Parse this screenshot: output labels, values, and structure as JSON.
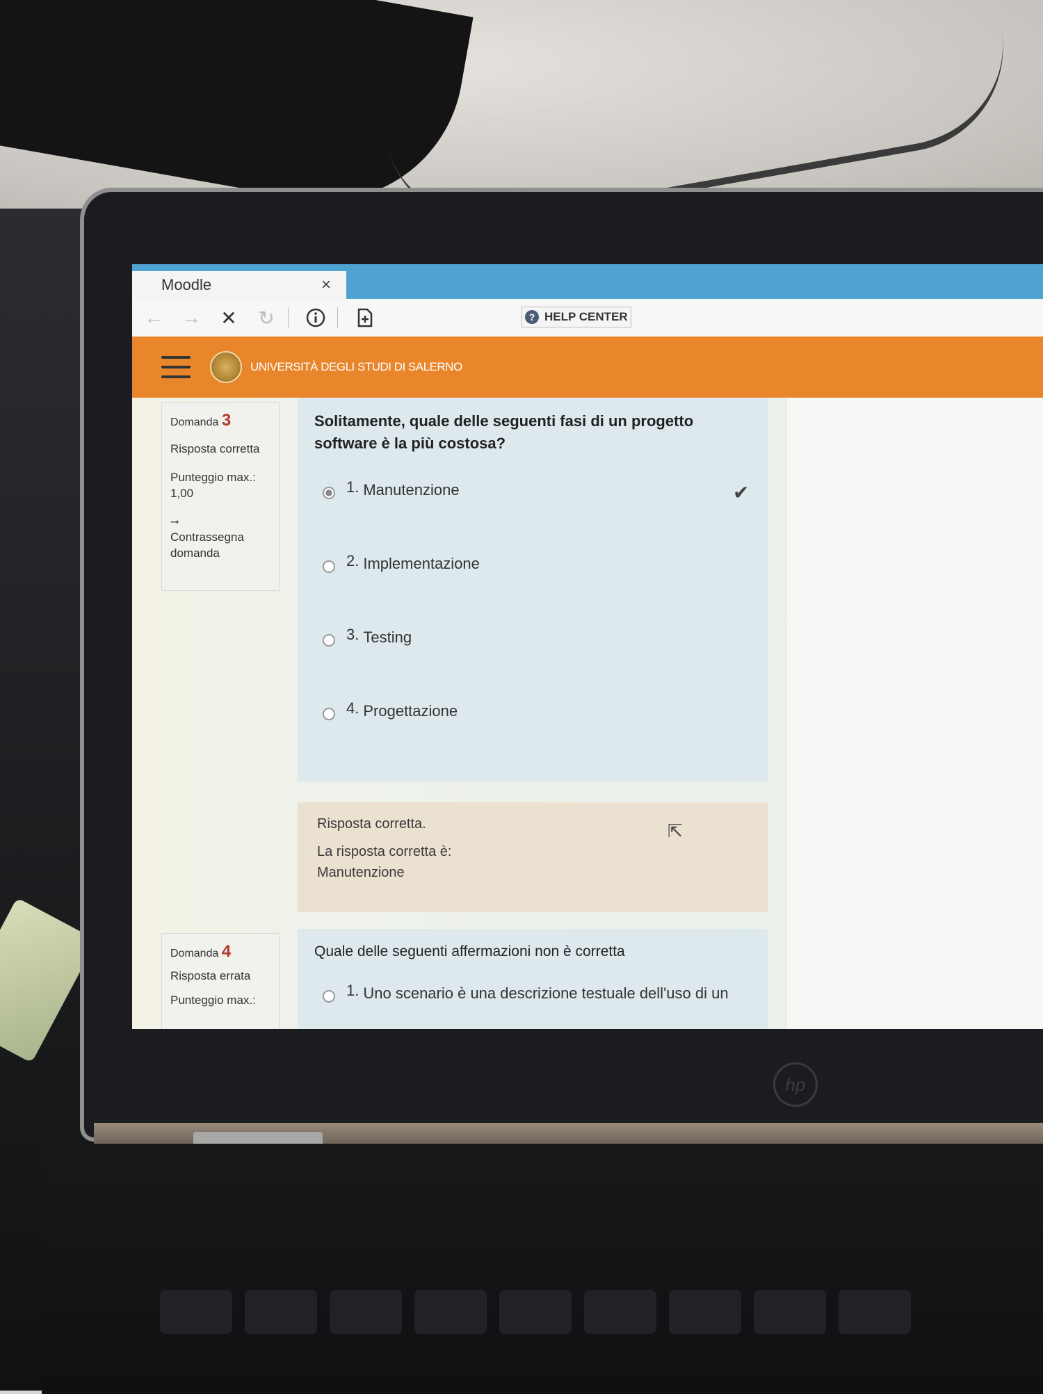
{
  "browser": {
    "tab_title": "Moodle",
    "tab_close": "×",
    "help_center": "HELP CENTER",
    "help_icon": "?",
    "icons": [
      "back-arrow-icon",
      "forward-arrow-icon",
      "stop-icon",
      "reload-icon",
      "info-icon",
      "add-page-icon"
    ]
  },
  "site": {
    "university": "UNIVERSITÀ DEGLI STUDI DI SALERNO",
    "brand_color": "#e9862c"
  },
  "question3": {
    "label": "Domanda",
    "number": "3",
    "status": "Risposta corretta",
    "max_score_label": "Punteggio max.:",
    "max_score": "1,00",
    "flag_label": "Contrassegna domanda",
    "text": "Solitamente, quale delle seguenti fasi di un progetto software è la più costosa?",
    "options": [
      {
        "num": "1.",
        "label": "Manutenzione",
        "selected": true
      },
      {
        "num": "2.",
        "label": "Implementazione",
        "selected": false
      },
      {
        "num": "3.",
        "label": "Testing",
        "selected": false
      },
      {
        "num": "4.",
        "label": "Progettazione",
        "selected": false
      }
    ],
    "feedback_status": "Risposta corretta.",
    "feedback_answer_label": "La risposta corretta è:",
    "feedback_answer": "Manutenzione"
  },
  "question4": {
    "label": "Domanda",
    "number": "4",
    "status": "Risposta errata",
    "max_score_label": "Punteggio max.:",
    "text": "Quale delle seguenti affermazioni non è corretta",
    "options": [
      {
        "num": "1.",
        "label": "Uno scenario è una descrizione testuale dell'uso di un"
      }
    ]
  }
}
